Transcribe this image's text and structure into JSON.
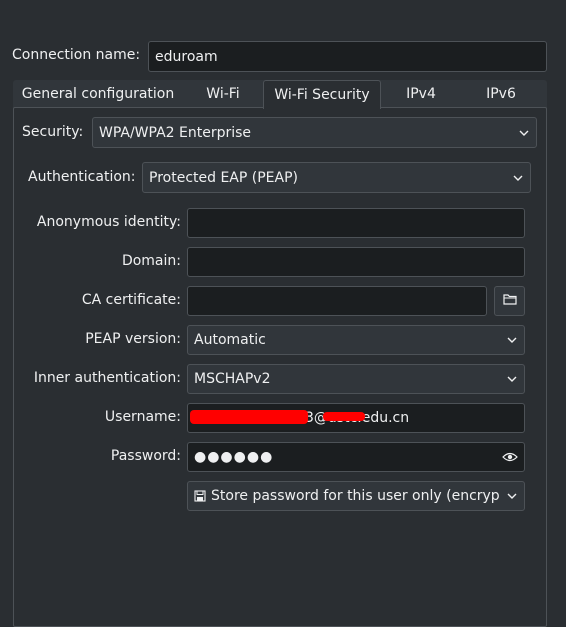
{
  "connection": {
    "name_label": "Connection name:",
    "name_value": "eduroam"
  },
  "tabs": [
    {
      "label": "General configuration"
    },
    {
      "label": "Wi-Fi"
    },
    {
      "label": "Wi-Fi Security"
    },
    {
      "label": "IPv4"
    },
    {
      "label": "IPv6"
    }
  ],
  "security": {
    "label": "Security:",
    "value": "WPA/WPA2 Enterprise"
  },
  "authentication": {
    "label": "Authentication:",
    "value": "Protected EAP (PEAP)"
  },
  "anonymous_identity": {
    "label": "Anonymous identity:",
    "value": ""
  },
  "domain": {
    "label": "Domain:",
    "value": ""
  },
  "ca_certificate": {
    "label": "CA certificate:",
    "value": ""
  },
  "peap_version": {
    "label": "PEAP version:",
    "value": "Automatic"
  },
  "inner_auth": {
    "label": "Inner authentication:",
    "value": "MSCHAPv2"
  },
  "username": {
    "label": "Username:",
    "value": "3@ustc.edu.cn"
  },
  "password": {
    "label": "Password:",
    "value": "●●●●●●"
  },
  "store_password": {
    "value": "Store password for this user only (encryp"
  },
  "icons": {
    "chevron": "chevron-down-icon",
    "folder": "folder-icon",
    "eye": "eye-icon",
    "save": "floppy-disk-icon"
  }
}
